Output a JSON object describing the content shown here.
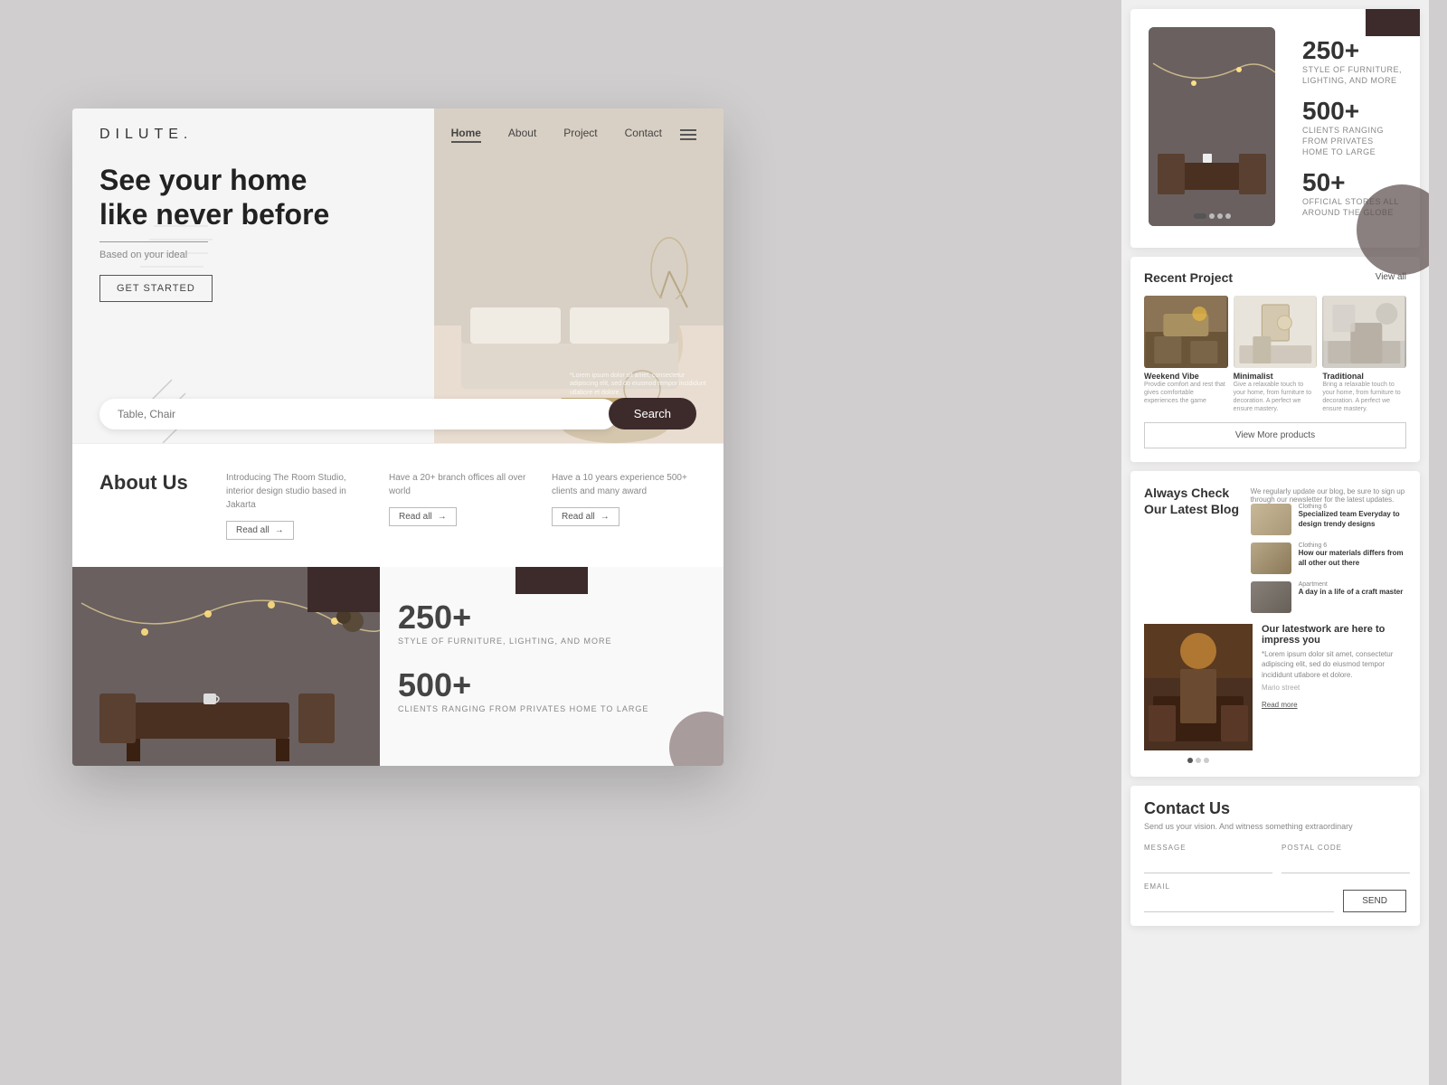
{
  "brand": {
    "logo": "DILUTE.",
    "tagline": "Based on your ideal"
  },
  "nav": {
    "links": [
      "Home",
      "About",
      "Project",
      "Contact"
    ],
    "active_link": "Home"
  },
  "hero": {
    "title": "See your home like never before",
    "subtitle": "Based on your ideal",
    "cta_button": "GET STARTED",
    "search_placeholder": "Table, Chair",
    "search_button": "Search",
    "lorem_text": "*Lorem ipsum dolor sit amet, consectetur adipiscing elit, sed do eiusmod tempor incididunt utlabore et dolore."
  },
  "about": {
    "title": "About Us",
    "items": [
      {
        "text": "Introducing The Room Studio, interior design studio based in Jakarta",
        "link": "Read all"
      },
      {
        "text": "Have a 20+ branch offices all over world",
        "link": "Read all"
      },
      {
        "text": "Have a 10 years experience 500+ clients and many award",
        "link": "Read all"
      }
    ]
  },
  "stats": {
    "items": [
      {
        "number": "250+",
        "label": "STYLE OF FURNITURE, LIGHTING, AND MORE"
      },
      {
        "number": "500+",
        "label": "CLIENTS RANGING FROM PRIVATES HOME TO LARGE"
      },
      {
        "number": "50+",
        "label": "OFFICIAL STORES ALL AROUND THE GLOBE"
      }
    ]
  },
  "right_stats": {
    "items": [
      {
        "number": "250+",
        "label": "STYLE OF FURNITURE, LIGHTING, AND MORE"
      },
      {
        "number": "500+",
        "label": "CLIENTS RANGING FROM PRIVATES HOME TO LARGE"
      },
      {
        "number": "50+",
        "label": "OFFICIAL STORES ALL AROUND THE GLOBE"
      }
    ]
  },
  "recent_projects": {
    "title": "Recent Project",
    "view_all": "View all",
    "projects": [
      {
        "name": "Weekend Vibe",
        "description": "Provdie comfort and rest that gives comfortable experiences the game"
      },
      {
        "name": "Minimalist",
        "description": "Give a relaxable touch to your home, from furniture to decoration. A perfect we ensure mastery."
      },
      {
        "name": "Traditional",
        "description": "Bring a relaxable touch to your home, from furniture to decoration. A perfect we ensure mastery."
      }
    ],
    "view_more_button": "View More products"
  },
  "blog": {
    "section_title": "Always Check Our Latest Blog",
    "section_desc": "We regularly update our blog, be sure to sign up through our newsletter for the latest updates.",
    "main_post": {
      "title": "Our latestwork are here to impress you",
      "text": "*Lorem ipsum dolor sit amet, consectetur adipiscing elit, sed do eiusmod tempor incididunt utlabore et dolore.",
      "read_more": "Read more",
      "author": "Mario street"
    },
    "side_posts": [
      {
        "category": "Clothing 6",
        "title": "Specialized team Everyday to design trendy designs"
      },
      {
        "category": "Clothing 6",
        "title": "How our materials differs from all other out there"
      },
      {
        "category": "Apartment",
        "title": "A day in a life of a craft master"
      }
    ]
  },
  "contact": {
    "title": "Contact Us",
    "subtitle": "Send us your vision. And witness something extraordinary",
    "form": {
      "message_label": "MESSAGE",
      "postal_code_label": "POSTAL CODE",
      "email_label": "EMAIL",
      "send_button": "SEND"
    }
  }
}
